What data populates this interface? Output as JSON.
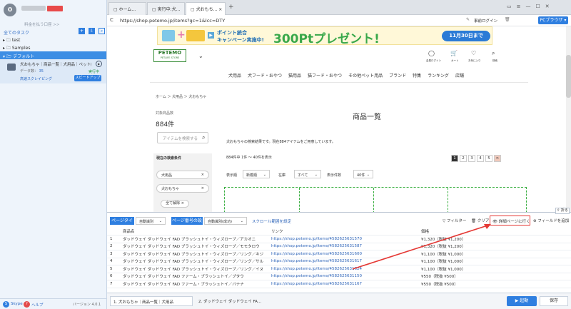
{
  "sidebar": {
    "sub": "料金を払う口座 >>",
    "all_tasks": "全てのタスク",
    "groups": [
      "test",
      "Samples",
      "デフォルト"
    ],
    "task": {
      "title": "犬おもちゃ｜商品一覧｜犬用品｜ペット総...",
      "data_label": "データ数：",
      "data_count": "35",
      "status": "実行中",
      "mode": "高速スクレイピング",
      "speed": "スピードアップ"
    },
    "footer": {
      "app": "Skype",
      "help": "ヘルプ",
      "version": "バージョン 4.0.1"
    }
  },
  "tabs": [
    "ホーム...",
    "実行中:犬...",
    "犬おもち..."
  ],
  "addressbar": {
    "url": "https://shop.petemo.jp/items?gc=1&lcc=DTY",
    "login": "事前ログイン",
    "browser_btn": "PCブラウザ"
  },
  "banner": {
    "line1": "ポイント統合",
    "line2": "キャンペーン実施中!",
    "big": "300Ptプレゼント!",
    "end": "11月30日まで"
  },
  "site": {
    "logo": "PETEMO",
    "logo_sub": "PETLIFE STORE",
    "icons": [
      "会員ログイン",
      "カート",
      "お気に入り",
      "検索"
    ],
    "nav": [
      "犬用品",
      "犬フード・おやつ",
      "猫用品",
      "猫フード・おやつ",
      "その他ペット用品",
      "ブランド",
      "特集",
      "ランキング",
      "店舗"
    ],
    "breadcrumb": "ホーム ＞ 犬用品 ＞ 犬おもちゃ",
    "title": "商品一覧",
    "count_label": "対象商品数",
    "count": "884件",
    "search_placeholder": "アイテムを検索する",
    "cond_label": "現在の検索条件",
    "chips": [
      "犬用品",
      "犬おもちゃ"
    ],
    "clear_all": "全て解除",
    "desc": "犬おもちゃの検索結果です。現在884アイテムをご用意しています。",
    "range": "884件中 1件 ～ 40件を表示",
    "pages": [
      "1",
      "2",
      "3",
      "4",
      "5",
      ">"
    ],
    "sort_label": "表示順",
    "sort_value": "新着順",
    "stock_label": "在庫",
    "stock_value": "すべて",
    "per_label": "表示件数",
    "per_value": "40件"
  },
  "toolbar": {
    "page_type_label": "ページタイプ",
    "page_type_value": "自動識別",
    "page_num_label": "ページ番号の設定",
    "page_num_value": "自動識別(成功)",
    "scroll_link": "スクロール範囲を設定",
    "filter": "フィルター",
    "clear": "クリア",
    "detail": "詳細ページに行く",
    "add_field": "フィールドを追加",
    "collapse": "折る"
  },
  "table": {
    "headers": [
      "商品名",
      "リンク",
      "価格"
    ],
    "rows": [
      [
        "1",
        "ダッドウェイ ダッドウェイ FAD ブラッシュトイ・ウィズローブ／アカオニ",
        "https://shop.petemo.jp/items/4582625631570",
        "¥1,320（税抜 ¥1,200）"
      ],
      [
        "2",
        "ダッドウェイ ダッドウェイ FAD ブラッシュトイ・ウィズローブ／モモタロウ",
        "https://shop.petemo.jp/items/4582625631587",
        "¥1,320（税抜 ¥1,200）"
      ],
      [
        "3",
        "ダッドウェイ ダッドウェイ FAD ブラッシュトイ・ウィズローブ／リング／キジ",
        "https://shop.petemo.jp/items/4582625631600",
        "¥1,100（税抜 ¥1,000）"
      ],
      [
        "4",
        "ダッドウェイ ダッドウェイ FAD ブラッシュトイ・ウィズローブ／リング／サル",
        "https://shop.petemo.jp/items/4582625631617",
        "¥1,100（税抜 ¥1,000）"
      ],
      [
        "5",
        "ダッドウェイ ダッドウェイ FAD ブラッシュトイ・ウィズローブ／リング／イヌ",
        "https://shop.petemo.jp/items/4582625631624",
        "¥1,100（税抜 ¥1,000）"
      ],
      [
        "6",
        "ダッドウェイ ダッドウェイ FAD ファーム・ブラッシュトイ／ブタウ",
        "https://shop.petemo.jp/items/4582625631150",
        "¥550（税抜 ¥500）"
      ],
      [
        "7",
        "ダッドウェイ ダッドウェイ FAD ファーム・ブラッシュトイ／バナナ",
        "https://shop.petemo.jp/items/4582625631167",
        "¥550（税抜 ¥500）"
      ]
    ]
  },
  "bottom": {
    "tabs": [
      "1. 犬おもちゃ｜商品一覧｜犬用品",
      "2. ダッドウェイ ダッドウェイ FA..."
    ],
    "start": "起動",
    "save": "保存"
  }
}
